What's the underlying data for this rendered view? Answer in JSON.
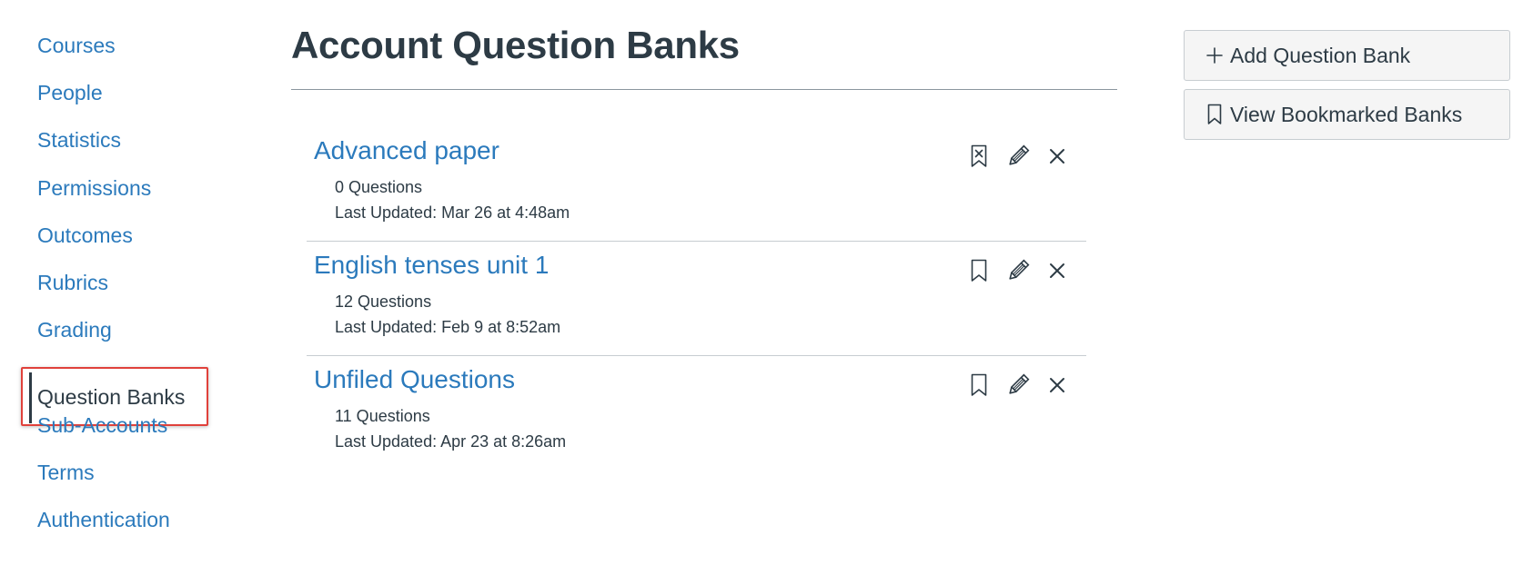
{
  "sidebar": {
    "items": [
      {
        "label": "Courses"
      },
      {
        "label": "People"
      },
      {
        "label": "Statistics"
      },
      {
        "label": "Permissions"
      },
      {
        "label": "Outcomes"
      },
      {
        "label": "Rubrics"
      },
      {
        "label": "Grading"
      },
      {
        "label": "Question Banks",
        "active": true
      },
      {
        "label": "Sub-Accounts"
      },
      {
        "label": "Terms"
      },
      {
        "label": "Authentication"
      }
    ]
  },
  "main": {
    "title": "Account Question Banks",
    "banks": [
      {
        "title": "Advanced paper",
        "count": "0 Questions",
        "updated": "Last Updated: Mar 26 at 4:48am",
        "bookmarked": true,
        "bookmark_icon": "bookmark-remove-icon"
      },
      {
        "title": "English tenses unit 1",
        "count": "12 Questions",
        "updated": "Last Updated: Feb 9 at 8:52am",
        "bookmarked": false,
        "bookmark_icon": "bookmark-icon"
      },
      {
        "title": "Unfiled Questions",
        "count": "11 Questions",
        "updated": "Last Updated: Apr 23 at 8:26am",
        "bookmarked": false,
        "bookmark_icon": "bookmark-icon"
      }
    ]
  },
  "actions": {
    "add_label": "Add Question Bank",
    "add_icon": "plus-icon",
    "view_bookmarked_label": "View Bookmarked Banks",
    "view_bookmarked_icon": "bookmark-icon"
  },
  "colors": {
    "link": "#2b7abc",
    "text": "#2d3b45",
    "highlight": "#e0413b",
    "button_bg": "#f5f5f5"
  }
}
